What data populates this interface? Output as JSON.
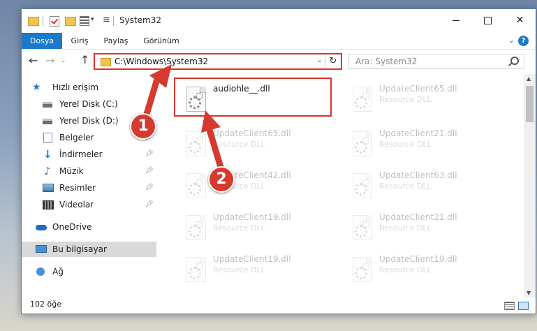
{
  "window": {
    "title": "System32"
  },
  "ribbon": {
    "tabs": [
      {
        "label": "Dosya"
      },
      {
        "label": "Giriş"
      },
      {
        "label": "Paylaş"
      },
      {
        "label": "Görünüm"
      }
    ],
    "help": "?"
  },
  "navbar": {
    "address": "C:\\Windows\\System32",
    "search_placeholder": "Ara: System32"
  },
  "sidebar": {
    "items": [
      {
        "label": "Hızlı erişim",
        "icon": "star-icon"
      },
      {
        "label": "Yerel Disk (C:)",
        "icon": "drive-icon"
      },
      {
        "label": "Yerel Disk (D:)",
        "icon": "drive-icon"
      },
      {
        "label": "Belgeler",
        "icon": "documents-icon"
      },
      {
        "label": "İndirmeler",
        "icon": "downloads-icon"
      },
      {
        "label": "Müzik",
        "icon": "music-icon"
      },
      {
        "label": "Resimler",
        "icon": "pictures-icon"
      },
      {
        "label": "Videolar",
        "icon": "videos-icon"
      },
      {
        "label": "OneDrive",
        "icon": "cloud-icon"
      },
      {
        "label": "Bu bilgisayar",
        "icon": "computer-icon"
      },
      {
        "label": "Ağ",
        "icon": "network-icon"
      }
    ]
  },
  "files": [
    {
      "name": "audiohle__.dll",
      "type": ""
    },
    {
      "name": "UpdateClient65.dll",
      "type": "Resource DLL"
    },
    {
      "name": "UpdateClient65.dll",
      "type": "Resource DLL"
    },
    {
      "name": "UpdateClient21.dll",
      "type": "Resource DLL"
    },
    {
      "name": "UpdateClient42.dll",
      "type": "Resource DLL"
    },
    {
      "name": "UpdateClient63.dll",
      "type": "Resource DLL"
    },
    {
      "name": "UpdateClient19.dll",
      "type": "Resource DLL"
    },
    {
      "name": "UpdateClient21.dll",
      "type": "Resource DLL"
    },
    {
      "name": "UpdateClient19.dll",
      "type": "Resource DLL"
    },
    {
      "name": "UpdateClient19.dll",
      "type": "Resource DLL"
    }
  ],
  "status": {
    "count": "102 öğe"
  },
  "annotations": {
    "step1": "1",
    "step2": "2"
  },
  "colors": {
    "accent": "#1979ca",
    "highlight": "#d9342b",
    "marker": "#d63a2f"
  }
}
